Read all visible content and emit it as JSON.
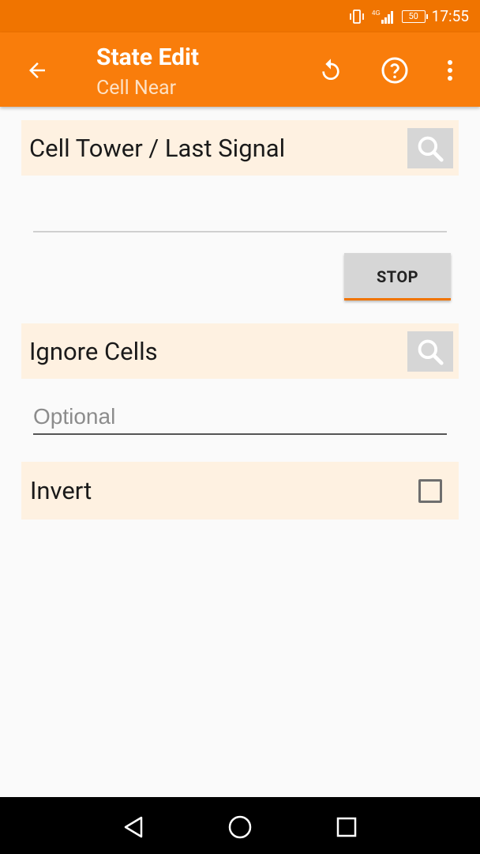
{
  "status_bar": {
    "time": "17:55",
    "battery": "50",
    "network": "4G"
  },
  "app_bar": {
    "title": "State Edit",
    "subtitle": "Cell Near",
    "icons": [
      "arrow-left-icon",
      "undo-icon",
      "help-icon",
      "more-vert-icon"
    ]
  },
  "cell_tower": {
    "label": "Cell Tower / Last Signal",
    "value": "",
    "stop_label": "STOP"
  },
  "ignore_cells": {
    "label": "Ignore Cells",
    "placeholder": "Optional",
    "value": ""
  },
  "invert": {
    "label": "Invert",
    "checked": false
  },
  "colors": {
    "status_bar": "#f07400",
    "app_bar": "#f97d0b",
    "card_bg": "#fef1e1",
    "accent": "#f07400"
  }
}
